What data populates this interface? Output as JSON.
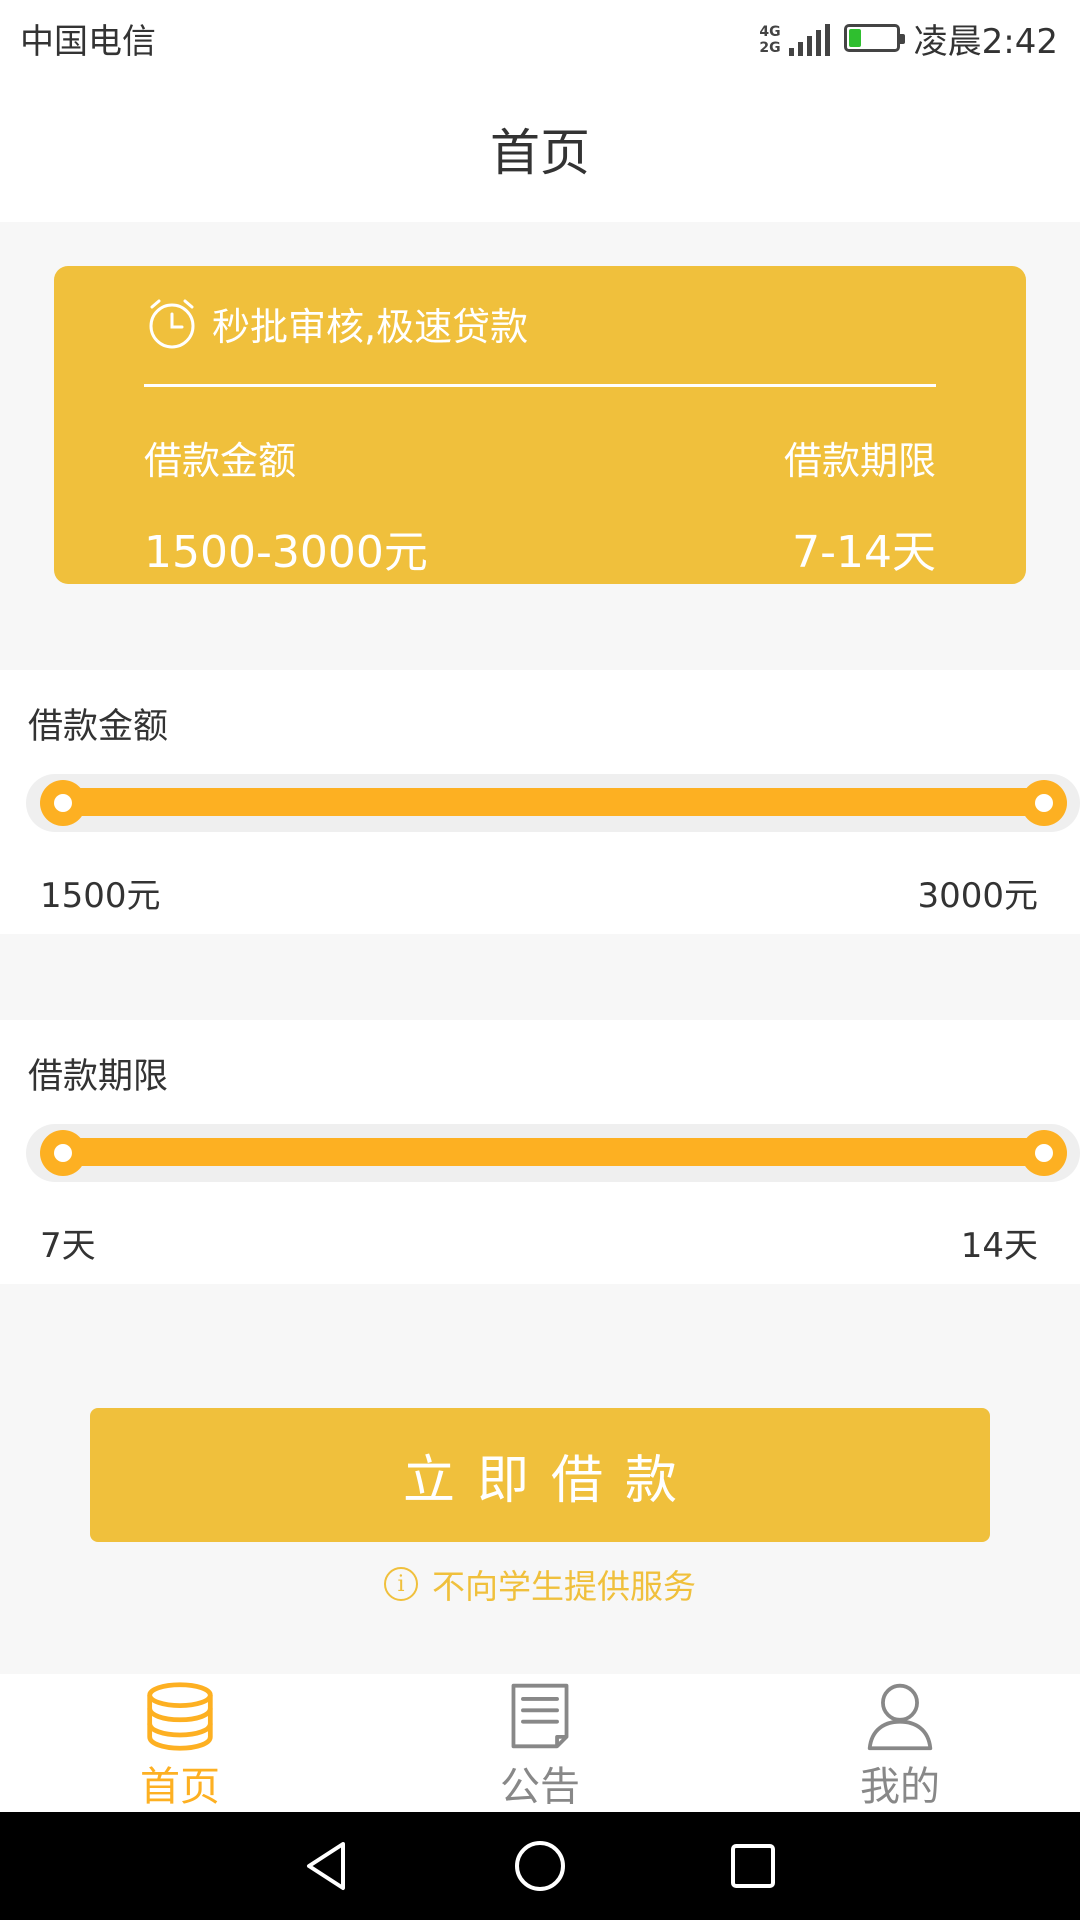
{
  "status_bar": {
    "carrier": "中国电信",
    "network_top": "4G",
    "network_bottom": "2G",
    "time": "凌晨2:42"
  },
  "header": {
    "title": "首页"
  },
  "promo": {
    "slogan": "秒批审核,极速贷款",
    "amount_label": "借款金额",
    "term_label": "借款期限",
    "amount_value": "1500-3000元",
    "term_value": "7-14天"
  },
  "amount_slider": {
    "label": "借款金额",
    "min_label": "1500元",
    "max_label": "3000元"
  },
  "term_slider": {
    "label": "借款期限",
    "min_label": "7天",
    "max_label": "14天"
  },
  "apply": {
    "button_label": "立即借款",
    "notice": "不向学生提供服务",
    "notice_icon": "i"
  },
  "bottom_nav": {
    "items": [
      {
        "label": "首页",
        "icon": "coins-icon",
        "active": true
      },
      {
        "label": "公告",
        "icon": "document-icon",
        "active": false
      },
      {
        "label": "我的",
        "icon": "person-icon",
        "active": false
      }
    ]
  },
  "colors": {
    "accent": "#f0c03c",
    "slider": "#fdb022",
    "battery": "#2fbf2f"
  }
}
